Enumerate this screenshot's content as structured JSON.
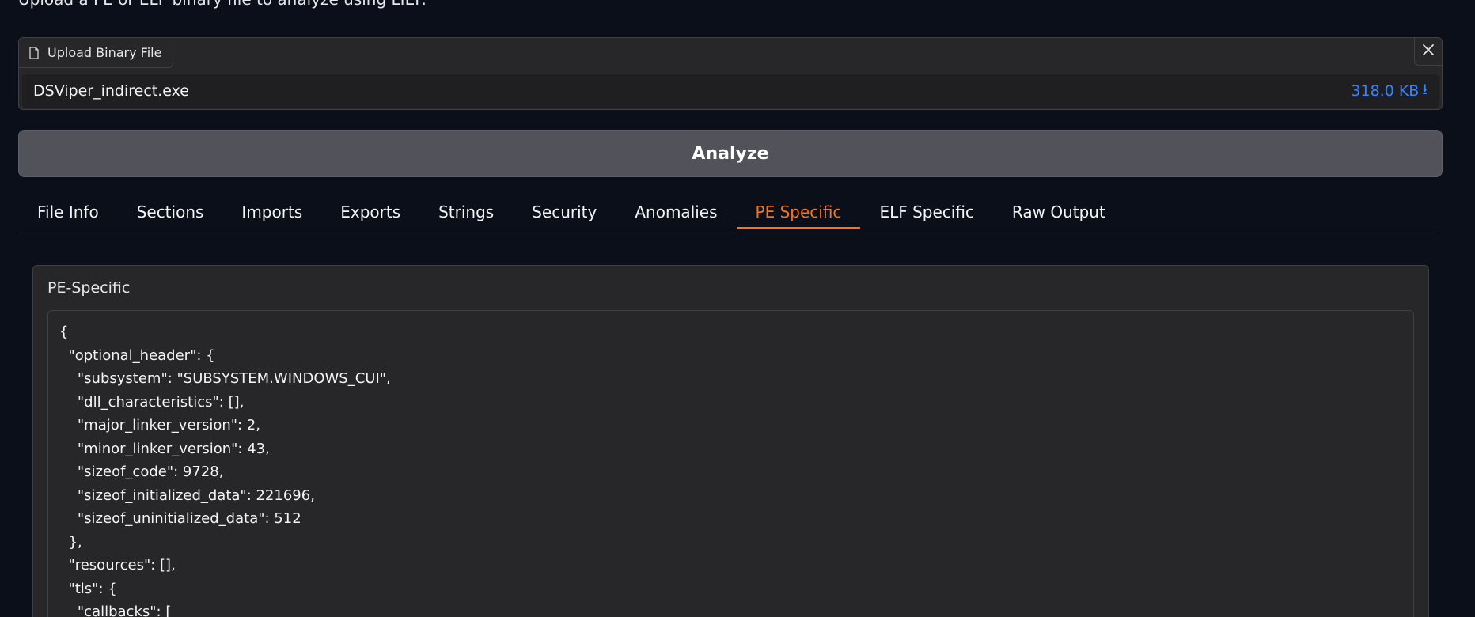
{
  "description": "Upload a PE or ELF binary file to analyze using LIEF.",
  "upload": {
    "label": "Upload Binary File",
    "file_name": "DSViper_indirect.exe",
    "file_size": "318.0 KB",
    "download_glyph": "⭳",
    "close_icon": "close-icon"
  },
  "analyze_label": "Analyze",
  "tabs": [
    {
      "label": "File Info",
      "active": false
    },
    {
      "label": "Sections",
      "active": false
    },
    {
      "label": "Imports",
      "active": false
    },
    {
      "label": "Exports",
      "active": false
    },
    {
      "label": "Strings",
      "active": false
    },
    {
      "label": "Security",
      "active": false
    },
    {
      "label": "Anomalies",
      "active": false
    },
    {
      "label": "PE Specific",
      "active": true
    },
    {
      "label": "ELF Specific",
      "active": false
    },
    {
      "label": "Raw Output",
      "active": false
    }
  ],
  "panel": {
    "label": "PE-Specific",
    "lines": [
      "{",
      "  \"optional_header\": {",
      "    \"subsystem\": \"SUBSYSTEM.WINDOWS_CUI\",",
      "    \"dll_characteristics\": [],",
      "    \"major_linker_version\": 2,",
      "    \"minor_linker_version\": 43,",
      "    \"sizeof_code\": 9728,",
      "    \"sizeof_initialized_data\": 221696,",
      "    \"sizeof_uninitialized_data\": 512",
      "  },",
      "  \"resources\": [],",
      "  \"tls\": {",
      "    \"callbacks\": ["
    ]
  },
  "colors": {
    "accent": "#f97316",
    "link": "#3b82f6",
    "background": "#0b0f19",
    "panel": "#27272a"
  }
}
